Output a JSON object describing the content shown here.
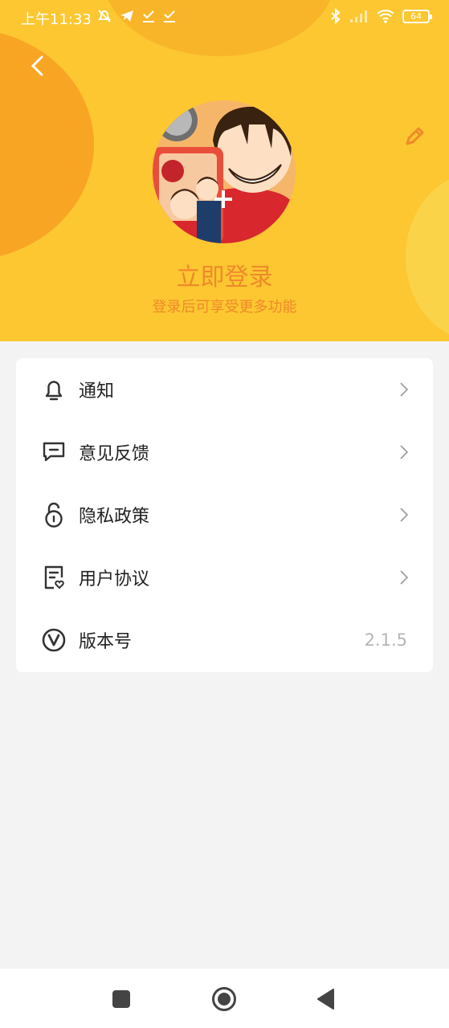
{
  "status_bar": {
    "time": "上午11:33",
    "battery": "64"
  },
  "profile": {
    "login_title": "立即登录",
    "login_subtitle": "登录后可享受更多功能"
  },
  "menu": {
    "items": [
      {
        "label": "通知",
        "icon": "bell-icon"
      },
      {
        "label": "意见反馈",
        "icon": "feedback-icon"
      },
      {
        "label": "隐私政策",
        "icon": "lock-icon"
      },
      {
        "label": "用户协议",
        "icon": "agreement-icon"
      },
      {
        "label": "版本号",
        "icon": "version-icon",
        "value": "2.1.5"
      }
    ]
  },
  "colors": {
    "header_bg": "#fcc731",
    "accent": "#f0892a",
    "page_bg": "#f3f3f3"
  }
}
